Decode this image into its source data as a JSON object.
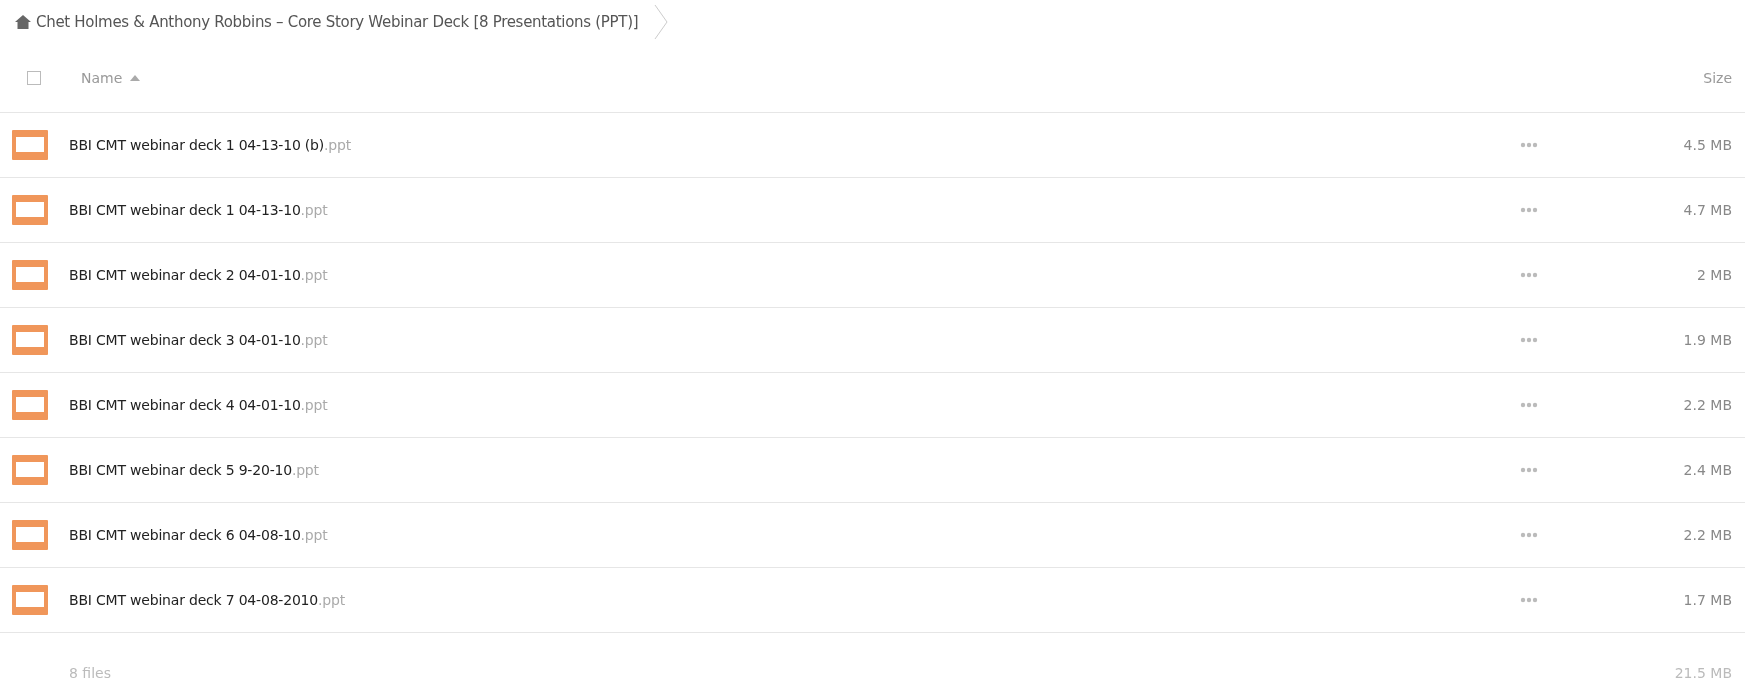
{
  "breadcrumb": {
    "title": "Chet Holmes & Anthony Robbins – Core Story Webinar Deck [8 Presentations (PPT)]"
  },
  "table": {
    "select_all_checked": false,
    "columns": [
      "Name",
      "Size"
    ],
    "rows": [
      {
        "name": "BBI CMT webinar deck 1 04-13-10 (b)",
        "extension": ".ppt",
        "size": "4.5 MB"
      },
      {
        "name": "BBI CMT webinar deck 1 04-13-10",
        "extension": ".ppt",
        "size": "4.7 MB"
      },
      {
        "name": "BBI CMT webinar deck 2 04-01-10",
        "extension": ".ppt",
        "size": "2 MB"
      },
      {
        "name": "BBI CMT webinar deck 3 04-01-10",
        "extension": ".ppt",
        "size": "1.9 MB"
      },
      {
        "name": "BBI CMT webinar deck 4 04-01-10",
        "extension": ".ppt",
        "size": "2.2 MB"
      },
      {
        "name": "BBI CMT webinar deck 5 9-20-10",
        "extension": ".ppt",
        "size": "2.4 MB"
      },
      {
        "name": "BBI CMT webinar deck 6 04-08-10",
        "extension": ".ppt",
        "size": "2.2 MB"
      },
      {
        "name": "BBI CMT webinar deck 7 04-08-2010",
        "extension": ".ppt",
        "size": "1.7 MB"
      }
    ]
  },
  "footer": {
    "count": "8 files",
    "total": "21.5 MB"
  }
}
